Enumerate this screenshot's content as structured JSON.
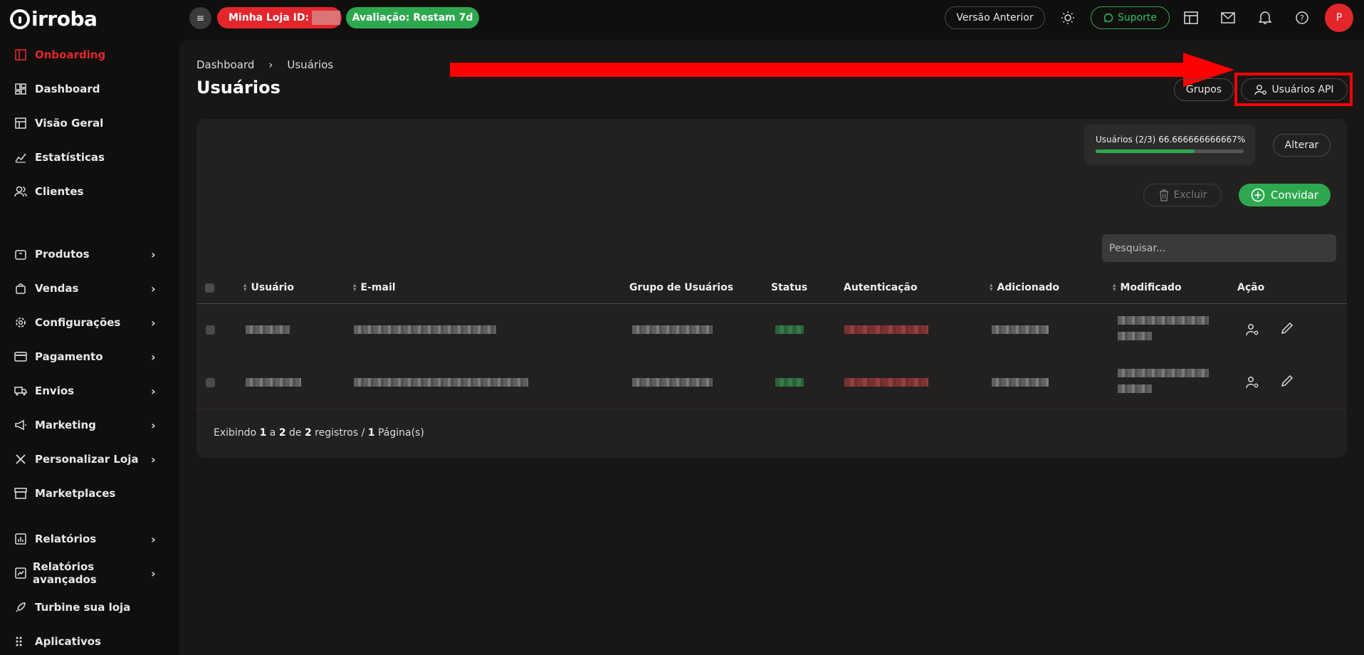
{
  "brand": {
    "name": "irroba"
  },
  "topbar": {
    "store_label": "Minha Loja ID:",
    "trial_label": "Avaliação: Restam 7d",
    "previous_version_label": "Versão Anterior",
    "support_label": "Suporte",
    "avatar_initial": "P"
  },
  "sidebar": {
    "items": [
      {
        "label": "Onboarding",
        "icon": "book-icon",
        "active": true
      },
      {
        "label": "Dashboard",
        "icon": "dashboard-icon"
      },
      {
        "label": "Visão Geral",
        "icon": "layout-icon"
      },
      {
        "label": "Estatísticas",
        "icon": "chart-line-icon"
      },
      {
        "label": "Clientes",
        "icon": "users-icon"
      },
      {
        "label": "Produtos",
        "icon": "package-icon",
        "chevron": true
      },
      {
        "label": "Vendas",
        "icon": "shopping-bag-icon",
        "chevron": true
      },
      {
        "label": "Configurações",
        "icon": "gear-icon",
        "chevron": true
      },
      {
        "label": "Pagamento",
        "icon": "credit-card-icon",
        "chevron": true
      },
      {
        "label": "Envios",
        "icon": "truck-icon",
        "chevron": true
      },
      {
        "label": "Marketing",
        "icon": "megaphone-icon",
        "chevron": true
      },
      {
        "label": "Personalizar Loja",
        "icon": "tools-icon",
        "chevron": true
      },
      {
        "label": "Marketplaces",
        "icon": "store-icon"
      },
      {
        "label": "Relatórios",
        "icon": "report-icon",
        "chevron": true
      },
      {
        "label": "Relatórios avançados",
        "icon": "advanced-report-icon",
        "chevron": true
      },
      {
        "label": "Turbine sua loja",
        "icon": "rocket-icon"
      },
      {
        "label": "Aplicativos",
        "icon": "apps-icon"
      }
    ]
  },
  "page": {
    "breadcrumb": [
      "Dashboard",
      "Usuários"
    ],
    "title": "Usuários",
    "groups_button": "Grupos",
    "api_users_button": "Usuários API"
  },
  "usage": {
    "label": "Usuários (2/3)",
    "percent_text": "66.666666666667%",
    "fraction": 0.6667,
    "change_button": "Alterar"
  },
  "actions": {
    "delete_label": "Excluir",
    "invite_label": "Convidar",
    "search_placeholder": "Pesquisar..."
  },
  "table": {
    "columns": [
      "Usuário",
      "E-mail",
      "Grupo de Usuários",
      "Status",
      "Autenticação",
      "Adicionado",
      "Modificado",
      "Ação"
    ]
  },
  "footer": {
    "prefix": "Exibindo",
    "from": "1",
    "to_word": "a",
    "to": "2",
    "of_word": "de",
    "total": "2",
    "records_word": "registros /",
    "pages": "1",
    "pages_word": "Página(s)"
  },
  "colors": {
    "accent_red": "#e3262c",
    "accent_green": "#2ea84f",
    "highlight": "#ff0000"
  }
}
